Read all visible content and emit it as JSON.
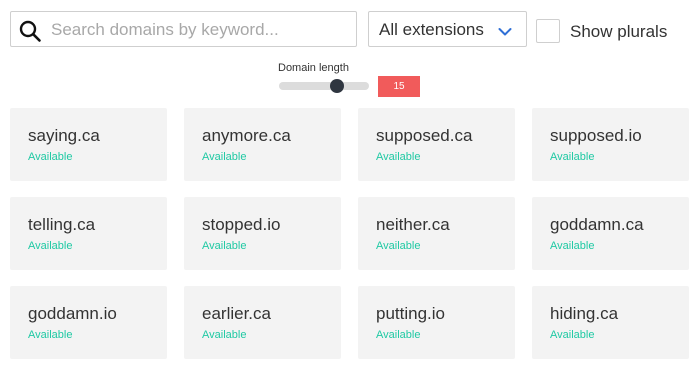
{
  "search": {
    "placeholder": "Search domains by keyword...",
    "value": "",
    "icon": "search-icon"
  },
  "extension_select": {
    "selected": "All extensions",
    "icon": "chevron-down-icon",
    "accent": "#2f6fd6"
  },
  "plurals": {
    "label": "Show plurals",
    "checked": false
  },
  "domain_length": {
    "label": "Domain length",
    "value": "15",
    "badge_color": "#f15b5b"
  },
  "status_color": "#1fc9a3",
  "results": [
    {
      "domain": "saying.ca",
      "status": "Available"
    },
    {
      "domain": "anymore.ca",
      "status": "Available"
    },
    {
      "domain": "supposed.ca",
      "status": "Available"
    },
    {
      "domain": "supposed.io",
      "status": "Available"
    },
    {
      "domain": "telling.ca",
      "status": "Available"
    },
    {
      "domain": "stopped.io",
      "status": "Available"
    },
    {
      "domain": "neither.ca",
      "status": "Available"
    },
    {
      "domain": "goddamn.ca",
      "status": "Available"
    },
    {
      "domain": "goddamn.io",
      "status": "Available"
    },
    {
      "domain": "earlier.ca",
      "status": "Available"
    },
    {
      "domain": "putting.io",
      "status": "Available"
    },
    {
      "domain": "hiding.ca",
      "status": "Available"
    }
  ]
}
